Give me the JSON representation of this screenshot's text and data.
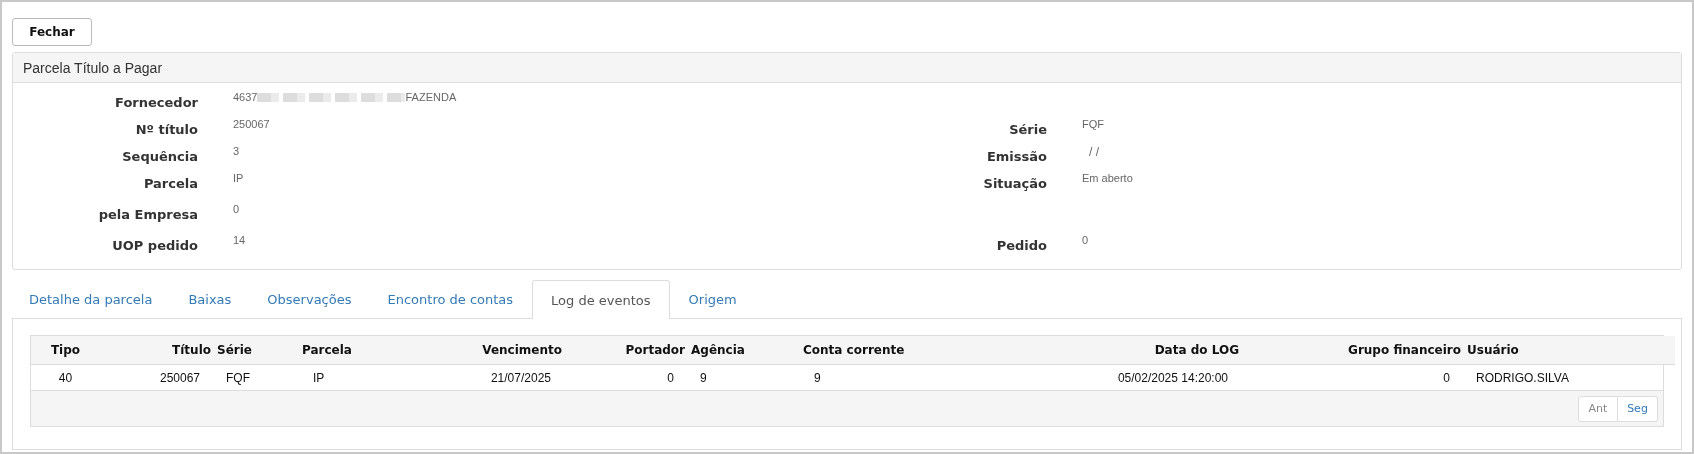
{
  "close_button": "Fechar",
  "panel": {
    "title": "Parcela Título a Pagar",
    "rows": [
      {
        "left": {
          "label": "Fornecedor",
          "value_start": "4637",
          "redacted": true,
          "value_end": "FAZENDA"
        },
        "right": null
      },
      {
        "left": {
          "label": "Nº título",
          "value": "250067"
        },
        "right": {
          "label": "Série",
          "value": "FQF"
        }
      },
      {
        "left": {
          "label": "Sequência",
          "value": "3"
        },
        "right": {
          "label": "Emissão",
          "value": "/ /"
        }
      },
      {
        "left": {
          "label": "Parcela",
          "value": "IP"
        },
        "right": {
          "label": "Situação",
          "value": "Em aberto"
        }
      },
      {
        "left": {
          "label": "pela Empresa",
          "value": "0"
        },
        "right": null
      },
      {
        "left": {
          "label": "UOP pedido",
          "value": "14"
        },
        "right": {
          "label": "Pedido",
          "value": "0"
        }
      }
    ]
  },
  "tabs": [
    {
      "label": "Detalhe da parcela",
      "selected": false
    },
    {
      "label": "Baixas",
      "selected": false
    },
    {
      "label": "Observações",
      "selected": false
    },
    {
      "label": "Encontro de contas",
      "selected": false
    },
    {
      "label": "Log de eventos",
      "selected": true
    },
    {
      "label": "Origem",
      "selected": false
    }
  ],
  "table": {
    "columns": [
      "Tipo",
      "Título",
      "Série",
      "Parcela",
      "Vencimento",
      "Portador",
      "Agência",
      "Conta corrente",
      "Data do LOG",
      "Grupo financeiro",
      "Usuário"
    ],
    "rows": [
      [
        "40",
        "250067",
        "FQF",
        "IP",
        "21/07/2025",
        "0",
        "9",
        "9",
        "05/02/2025 14:20:00",
        "0",
        "RODRIGO.SILVA"
      ]
    ]
  },
  "pager": [
    {
      "label": "Ant",
      "disabled": true
    },
    {
      "label": "Seg",
      "disabled": false
    }
  ]
}
